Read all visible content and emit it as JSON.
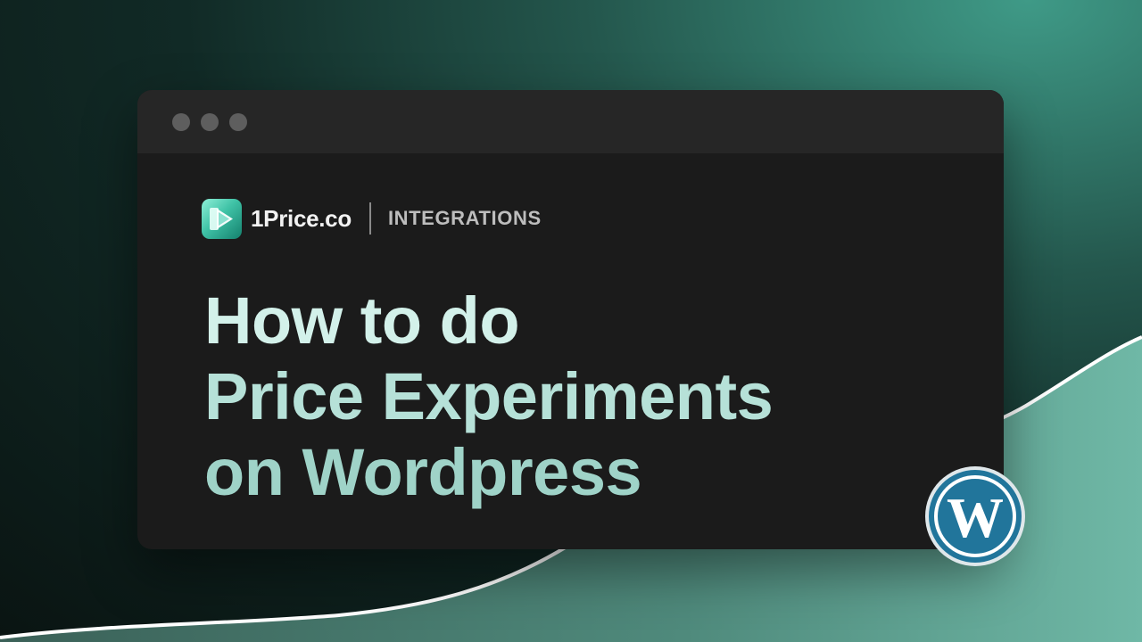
{
  "window": {
    "controls": [
      "close",
      "minimize",
      "maximize"
    ]
  },
  "brand": {
    "name": "1Price.co",
    "section": "INTEGRATIONS",
    "icon": "play-icon"
  },
  "headline": {
    "line1": "How to do",
    "line2": "Price Experiments",
    "line3": "on Wordpress"
  },
  "integration_logo": {
    "icon": "wordpress-icon",
    "letter": "W"
  },
  "colors": {
    "background_dark": "#0a1412",
    "background_teal": "#3f9a87",
    "window_bg": "#1b1b1b",
    "titlebar_bg": "#262626",
    "headline_light": "#d3f1ea",
    "headline_teal": "#9fd3c8",
    "wordpress_blue": "#21759b"
  }
}
